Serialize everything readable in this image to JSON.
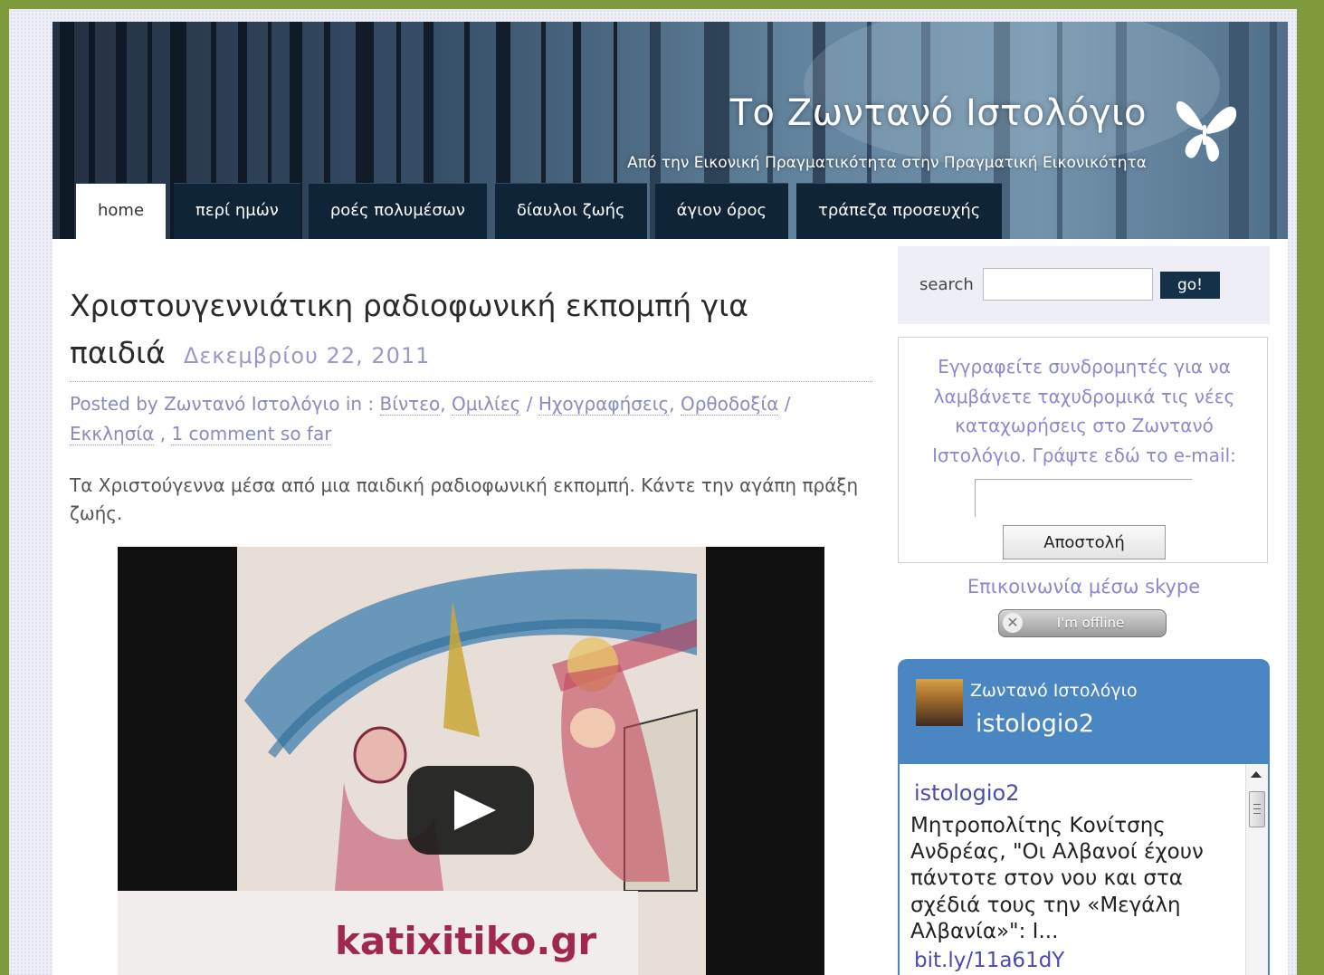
{
  "site": {
    "title": "Το Ζωντανό Ιστολόγιο",
    "tagline": "Από την Εικονική Πραγματικότητα στην Πραγματική Εικονικότητα"
  },
  "nav": [
    "home",
    "περί ημών",
    "ροές πολυμέσων",
    "δίαυλοι ζωής",
    "άγιον όρος",
    "τράπεζα προσευχής"
  ],
  "post": {
    "title": "Χριστουγεννιάτικη ραδιοφωνική εκπομπή για παιδιά",
    "date": "Δεκεμβρίου 22, 2011",
    "meta_prefix": "Posted by Ζωντανό Ιστολόγιο in :",
    "categories": [
      "Βίντεο",
      "Ομιλίες",
      "Ηχογραφήσεις",
      "Ορθοδοξία",
      "Εκκλησία"
    ],
    "comments": "1 comment so far",
    "body": "Τα Χριστούγεννα μέσα από μια παιδική ραδιοφωνική εκπομπή. Κάντε την αγάπη πράξη ζωής.",
    "video_watermark": "katixitiko.gr"
  },
  "sidebar": {
    "search_label": "search",
    "search_button": "go!",
    "subscribe_text": "Εγγραφείτε συνδρομητές για να λαμβάνετε ταχυδρομικά τις νέες καταχωρήσεις στο Ζωντανό Ιστολόγιο. Γράψτε εδώ το e-mail:",
    "submit_button": "Αποστολή",
    "skype_title": "Επικοινωνία μέσω skype",
    "skype_status": "I'm offline",
    "twitter": {
      "name": "Ζωντανό Ιστολόγιο",
      "handle": "istologio2",
      "tweet_author": "istologio2",
      "tweet_text": "Μητροπολίτης Κονίτσης Ανδρέας, \"Οι Αλβανοί έχουν πάντοτε στον νου και στα σχέδιά τους την «Μεγάλη Αλβανία»\": Ι...",
      "tweet_link": "bit.ly/11a61dY"
    }
  },
  "colors": {
    "accent_link": "#8b8bc3",
    "nav_bg": "#0f2436",
    "twitter_blue": "#4a86c1",
    "page_bg_green": "#7f9a3c"
  }
}
